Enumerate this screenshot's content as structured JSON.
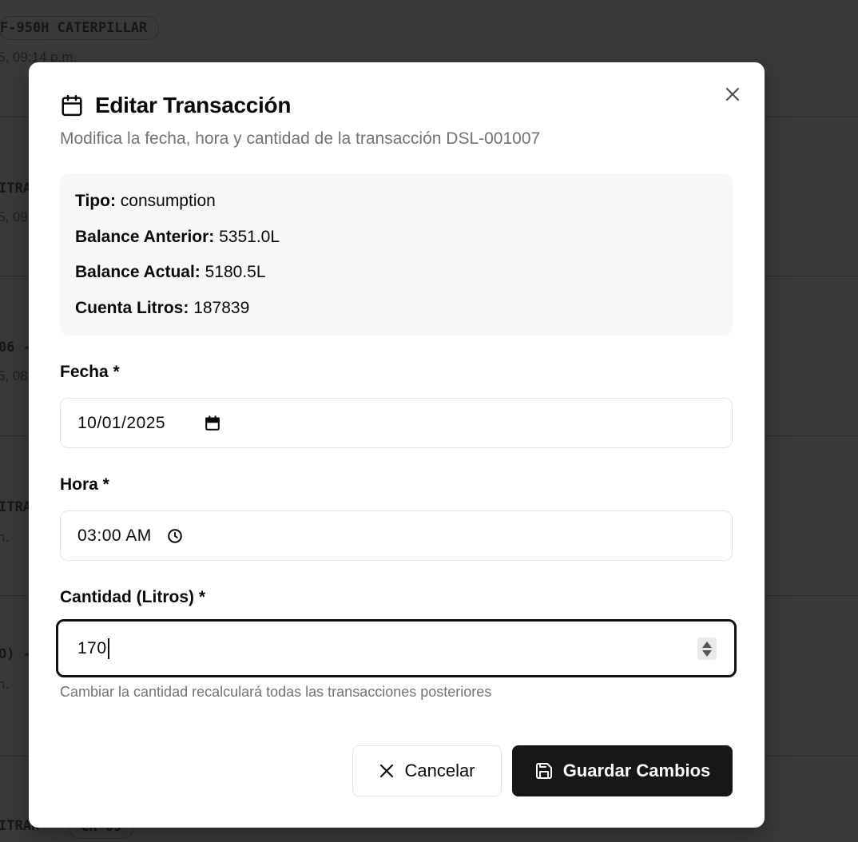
{
  "background": {
    "rows": [
      {
        "chip": "F-950H CATERPILLAR",
        "sub": "5, 09:14 p.m."
      },
      {
        "chip": "ITRA",
        "sub": "5, 09"
      },
      {
        "chip": "06 -",
        "sub": "5, 08"
      },
      {
        "chip": "ITRA",
        "sub": "n."
      },
      {
        "chip": "O) -",
        "sub": "n."
      },
      {
        "chip": "ITRAK",
        "chip2": "CR-09"
      }
    ]
  },
  "modal": {
    "title": "Editar Transacción",
    "subtitle": "Modifica la fecha, hora y cantidad de la transacción DSL-001007",
    "info": {
      "tipo_label": "Tipo:",
      "tipo_value": "consumption",
      "balance_anterior_label": "Balance Anterior:",
      "balance_anterior_value": "5351.0L",
      "balance_actual_label": "Balance Actual:",
      "balance_actual_value": "5180.5L",
      "cuenta_litros_label": "Cuenta Litros:",
      "cuenta_litros_value": "187839"
    },
    "fecha": {
      "label": "Fecha *",
      "value": "10/01/2025"
    },
    "hora": {
      "label": "Hora *",
      "value": "03:00 AM"
    },
    "cantidad": {
      "label": "Cantidad (Litros) *",
      "value": "170"
    },
    "helper": "Cambiar la cantidad recalculará todas las transacciones posteriores",
    "buttons": {
      "cancel": "Cancelar",
      "save": "Guardar Cambios"
    }
  },
  "icons": {
    "title": "calendar-icon",
    "close": "close-icon",
    "date_picker": "calendar-picker-icon",
    "time_picker": "clock-icon",
    "cancel": "x-icon",
    "save": "save-icon"
  }
}
